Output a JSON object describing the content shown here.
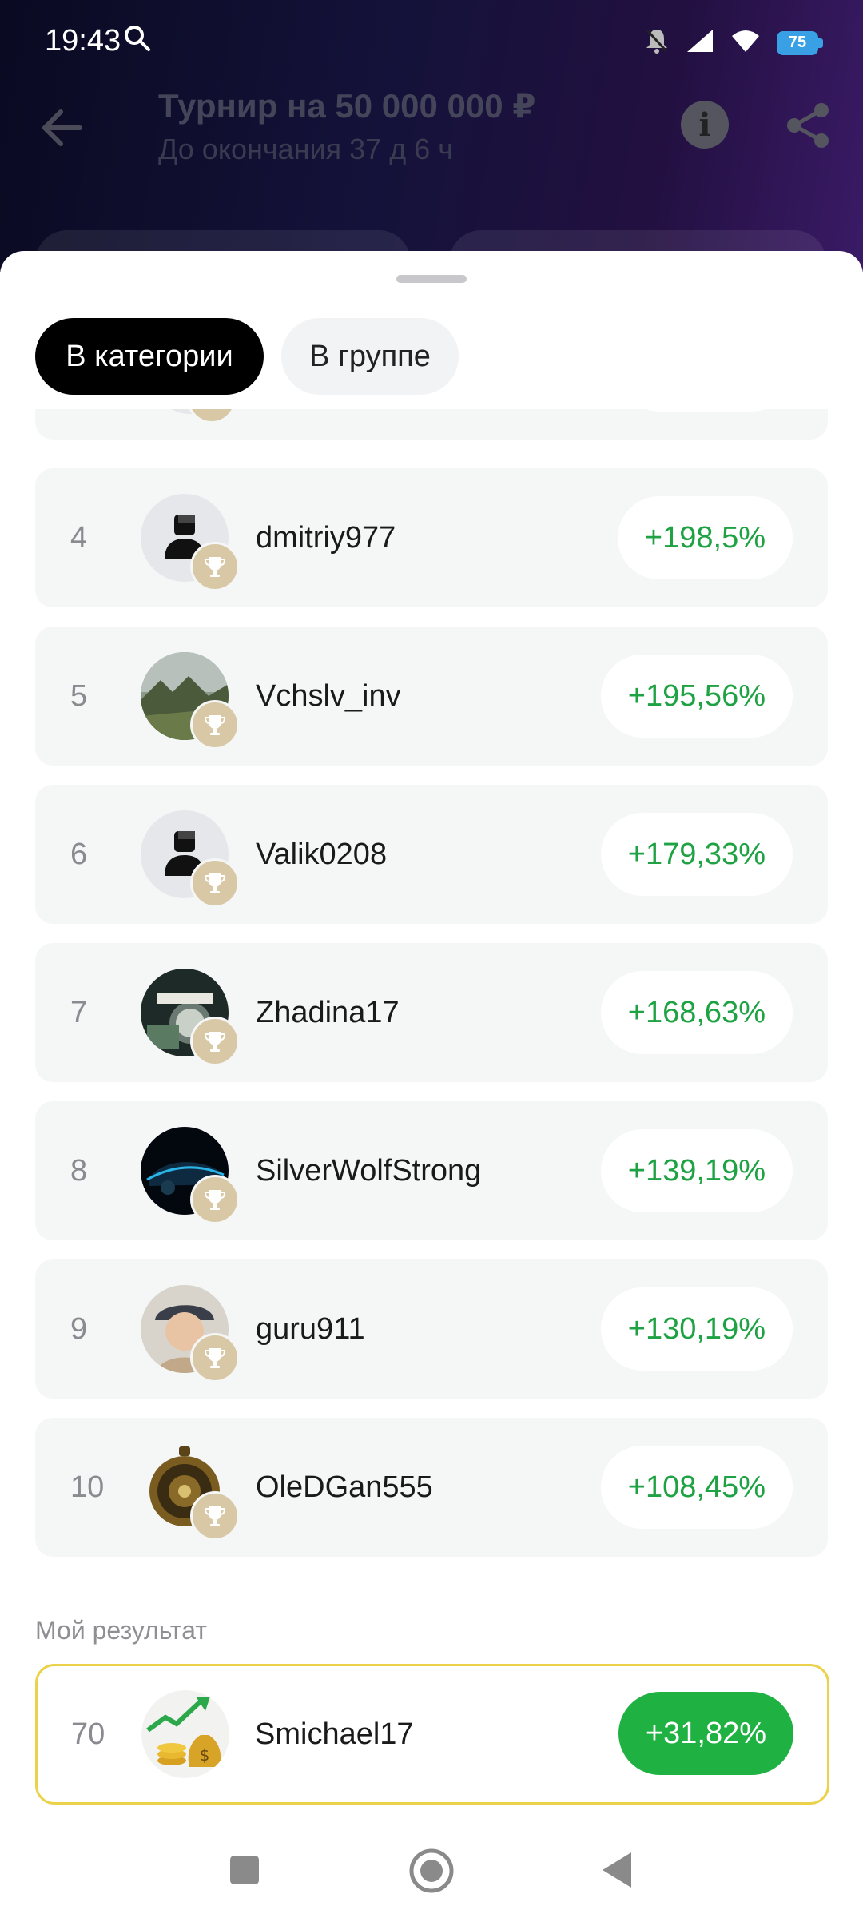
{
  "status": {
    "time": "19:43",
    "battery": "75"
  },
  "header": {
    "title": "Турнир на 50 000 000 ₽",
    "subtitle": "До окончания 37 д 6 ч"
  },
  "tabs": [
    {
      "label": "В категории",
      "active": true
    },
    {
      "label": "В группе",
      "active": false
    }
  ],
  "rows": [
    {
      "rank": "4",
      "name": "dmitriy977",
      "change": "+198,5%",
      "avatar": "default-avatar-icon"
    },
    {
      "rank": "5",
      "name": "Vchslv_inv",
      "change": "+195,56%",
      "avatar": "photo-landscape"
    },
    {
      "rank": "6",
      "name": "Valik0208",
      "change": "+179,33%",
      "avatar": "default-avatar-icon"
    },
    {
      "rank": "7",
      "name": "Zhadina17",
      "change": "+168,63%",
      "avatar": "photo-time-is-money"
    },
    {
      "rank": "8",
      "name": "SilverWolfStrong",
      "change": "+139,19%",
      "avatar": "photo-car"
    },
    {
      "rank": "9",
      "name": "guru911",
      "change": "+130,19%",
      "avatar": "photo-child"
    },
    {
      "rank": "10",
      "name": "OleDGan555",
      "change": "+108,45%",
      "avatar": "photo-medallion"
    }
  ],
  "my_result": {
    "label": "Мой результат",
    "rank": "70",
    "name": "Smichael17",
    "change": "+31,82%"
  },
  "colors": {
    "positive": "#1fa244",
    "accent_border": "#ecd24a",
    "my_badge": "#1fb141"
  }
}
